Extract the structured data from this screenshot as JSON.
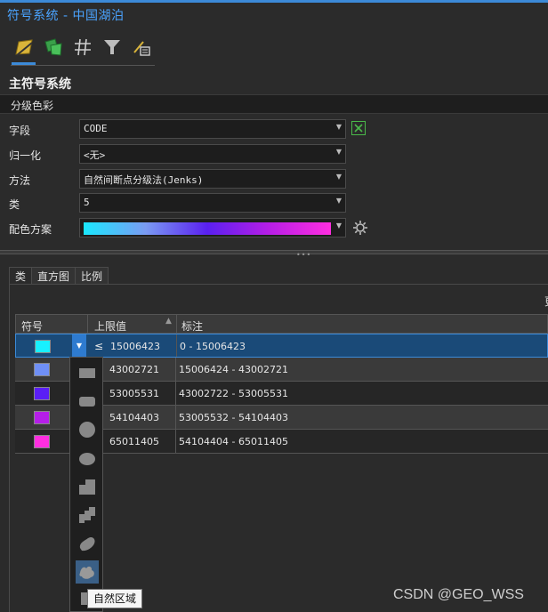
{
  "window": {
    "title": "符号系统 - 中国湖泊"
  },
  "toolbar": {
    "tools": [
      "primary-symbology-icon",
      "vary-symbology-icon",
      "grid-icon",
      "filter-icon",
      "label-settings-icon"
    ]
  },
  "section": {
    "title": "主符号系统"
  },
  "mode": {
    "value": "分级色彩"
  },
  "fields": {
    "field_label": "字段",
    "field_value": "CODE",
    "normalize_label": "归一化",
    "normalize_value": "<无>",
    "method_label": "方法",
    "method_value": "自然间断点分级法(Jenks)",
    "classes_label": "类",
    "classes_value": "5",
    "ramp_label": "配色方案"
  },
  "tabs": [
    {
      "label": "类"
    },
    {
      "label": "直方图"
    },
    {
      "label": "比例"
    }
  ],
  "panel": {
    "cutoff_text": "更"
  },
  "table": {
    "headers": {
      "symbol": "符号",
      "upper": "上限值",
      "label": "标注"
    },
    "rows": [
      {
        "color": "#18f0ff",
        "le": "≤",
        "upper": "15006423",
        "label": "0 - 15006423"
      },
      {
        "color": "#6f8ff5",
        "upper": "43002721",
        "label": "15006424 - 43002721"
      },
      {
        "color": "#5a1ef5",
        "upper": "53005531",
        "label": "43002722 - 53005531"
      },
      {
        "color": "#b51ee8",
        "upper": "54104403",
        "label": "53005532 - 54104403"
      },
      {
        "color": "#ff2ee0",
        "upper": "65011405",
        "label": "54104404 - 65011405"
      }
    ]
  },
  "tooltip": {
    "text": "自然区域"
  },
  "watermark": {
    "text": "CSDN @GEO_WSS"
  }
}
